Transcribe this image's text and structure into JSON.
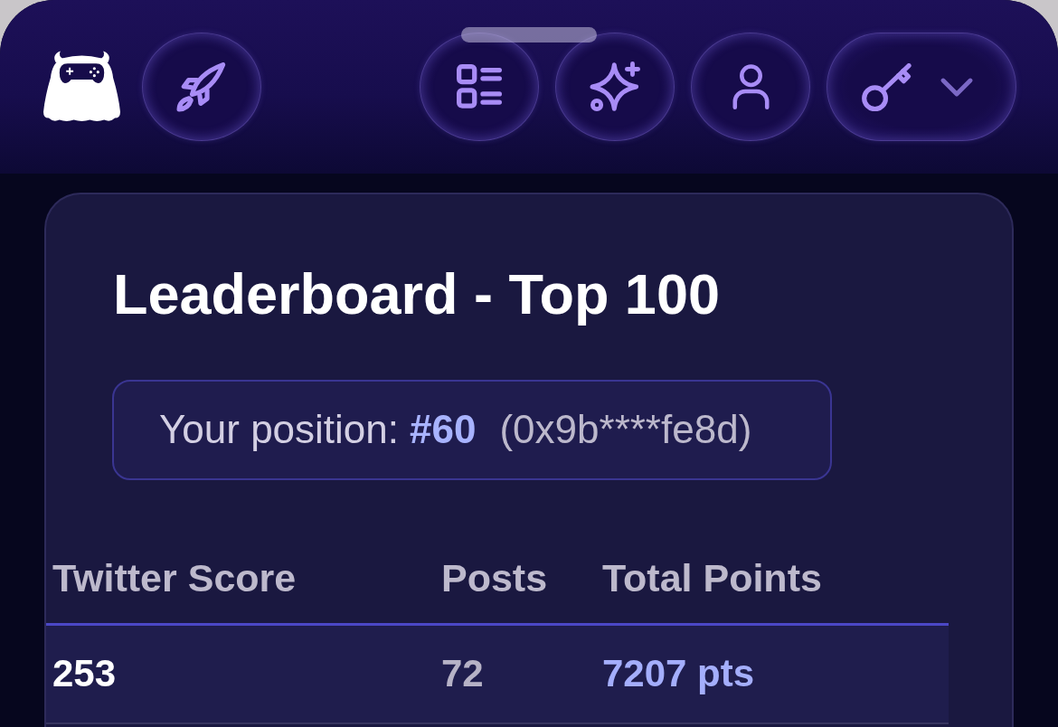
{
  "leaderboard": {
    "title": "Leaderboard - Top 100",
    "position": {
      "label": "Your position:",
      "rank": "#60",
      "address": "(0x9b****fe8d)"
    },
    "table": {
      "columns": [
        "Twitter Score",
        "Posts",
        "Total Points"
      ],
      "rows": [
        {
          "cells": [
            "253",
            "72",
            "7207 pts"
          ]
        }
      ]
    }
  }
}
